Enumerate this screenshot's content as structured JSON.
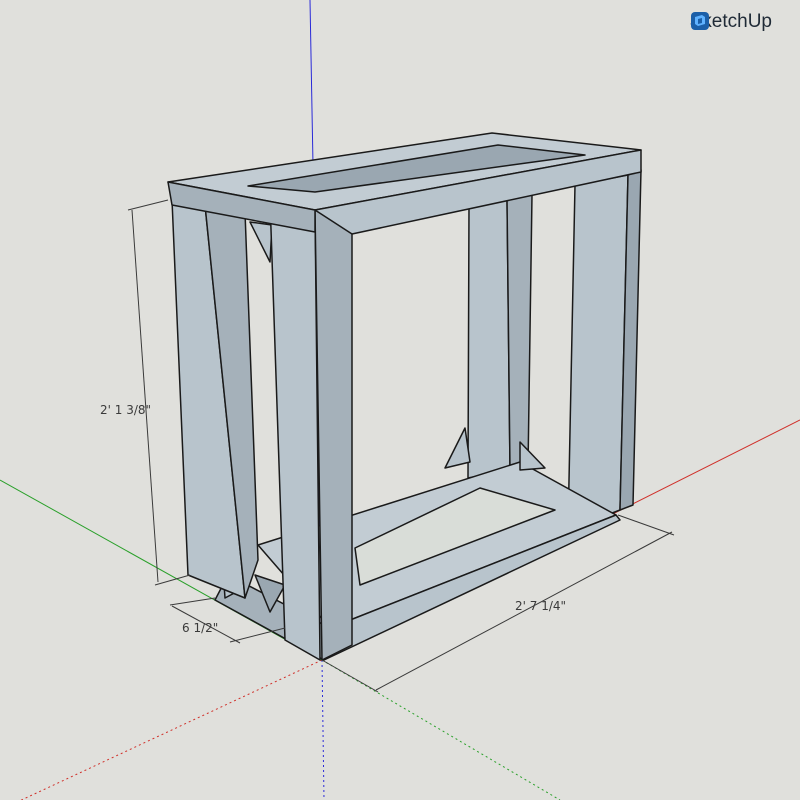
{
  "app": {
    "brand_label": "SketchUp",
    "logo_icon": "sketchup-logo-icon"
  },
  "viewport": {
    "background_color": "#e0e0dc",
    "model_face_color": "#b8c4cc",
    "model_face_dark_color": "#9aa7b1",
    "edge_color": "#1a1a1a"
  },
  "axes": {
    "red_axis_color": "#d0302a",
    "green_axis_color": "#2aa02a",
    "blue_axis_color": "#2a2ad8"
  },
  "dimensions": {
    "height_label": "2' 1 3/8\"",
    "width_label": "2' 7 1/4\"",
    "depth_label": "6 1/2\""
  }
}
